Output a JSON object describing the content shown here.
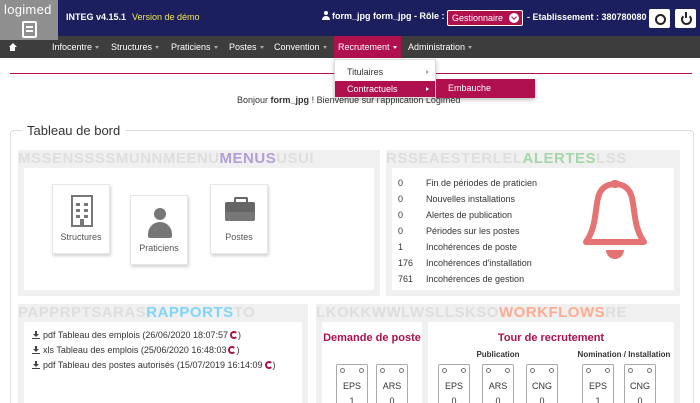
{
  "header": {
    "logo_text": "logimed",
    "app_name": "INTEG v4.15.1",
    "version_label": "Version de démo",
    "user_text": "form_jpg form_jpg - Rôle :",
    "role_value": "Gestionnaire",
    "etablissement": "- Etablissement : 380780080"
  },
  "nav": {
    "items": [
      {
        "label": "Infocentre"
      },
      {
        "label": "Structures"
      },
      {
        "label": "Praticiens"
      },
      {
        "label": "Postes"
      },
      {
        "label": "Convention"
      },
      {
        "label": "Recrutement"
      },
      {
        "label": "Administration"
      }
    ],
    "active": "Recrutement"
  },
  "dropdown": {
    "items": [
      {
        "label": "Titulaires"
      },
      {
        "label": "Contractuels"
      }
    ],
    "submenu": {
      "label": "Embauche"
    }
  },
  "greeting": {
    "prefix": "Bonjour",
    "user": "form_jpg",
    "suffix": "! Bienvenue sur l'application Logimed"
  },
  "dashboard": {
    "title": "Tableau de bord",
    "menus": {
      "bg_text": "MSSENSSSSMUNNMEENU",
      "title": "MENUS",
      "bg_tail": "USUI",
      "tiles": [
        {
          "label": "Structures",
          "icon": "building-icon"
        },
        {
          "label": "Praticiens",
          "icon": "person-icon"
        },
        {
          "label": "Postes",
          "icon": "briefcase-icon"
        }
      ]
    },
    "alertes": {
      "bg_text": "RSSEAESTERLEL",
      "title": "ALERTES",
      "bg_tail": "LSS",
      "rows": [
        {
          "count": "0",
          "label": "Fin de périodes de praticien"
        },
        {
          "count": "0",
          "label": "Nouvelles installations"
        },
        {
          "count": "0",
          "label": "Alertes de publication"
        },
        {
          "count": "0",
          "label": "Périodes sur les postes"
        },
        {
          "count": "1",
          "label": "Incohérences de poste"
        },
        {
          "count": "176",
          "label": "Incohérences d'installation"
        },
        {
          "count": "761",
          "label": "Incohérences de gestion"
        }
      ],
      "bell_color": "#e57373"
    },
    "rapports": {
      "bg_text": "PAPPRPTSARAS",
      "title": "RAPPORTS",
      "bg_tail": "TO",
      "reports": [
        {
          "type": "pdf",
          "label": "Tableau des emplois (26/06/2020 18:07:57"
        },
        {
          "type": "xls",
          "label": "Tableau des emplois (25/06/2020 16:48:03"
        },
        {
          "type": "pdf",
          "label": "Tableau des postes autorisés (15/07/2019 16:14:09"
        }
      ]
    },
    "workflows": {
      "bg_text": "LKOKKWWLWSLLSKSO",
      "title": "WORKFLOWS",
      "bg_tail": "RE",
      "demande": {
        "title": "Demande de poste",
        "boxes": [
          {
            "label": "EPS",
            "value": "1"
          },
          {
            "label": "ARS",
            "value": "0"
          }
        ]
      },
      "tour": {
        "title": "Tour de recrutement",
        "publication_label": "Publication",
        "nomination_label": "Nomination / Installation",
        "publication": [
          {
            "label": "EPS",
            "value": "0"
          },
          {
            "label": "ARS",
            "value": "0"
          },
          {
            "label": "CNG",
            "value": "0"
          }
        ],
        "nomination": [
          {
            "label": "EPS",
            "value": "1"
          },
          {
            "label": "CNG",
            "value": "0"
          }
        ]
      }
    }
  },
  "colors": {
    "brand_navy": "#1c1f5e",
    "accent": "#b0104e",
    "menus_title": "#b39ddb",
    "alertes_title": "#a5d6a7",
    "rapports_title": "#81d4fa",
    "workflows_title": "#ffab91"
  }
}
